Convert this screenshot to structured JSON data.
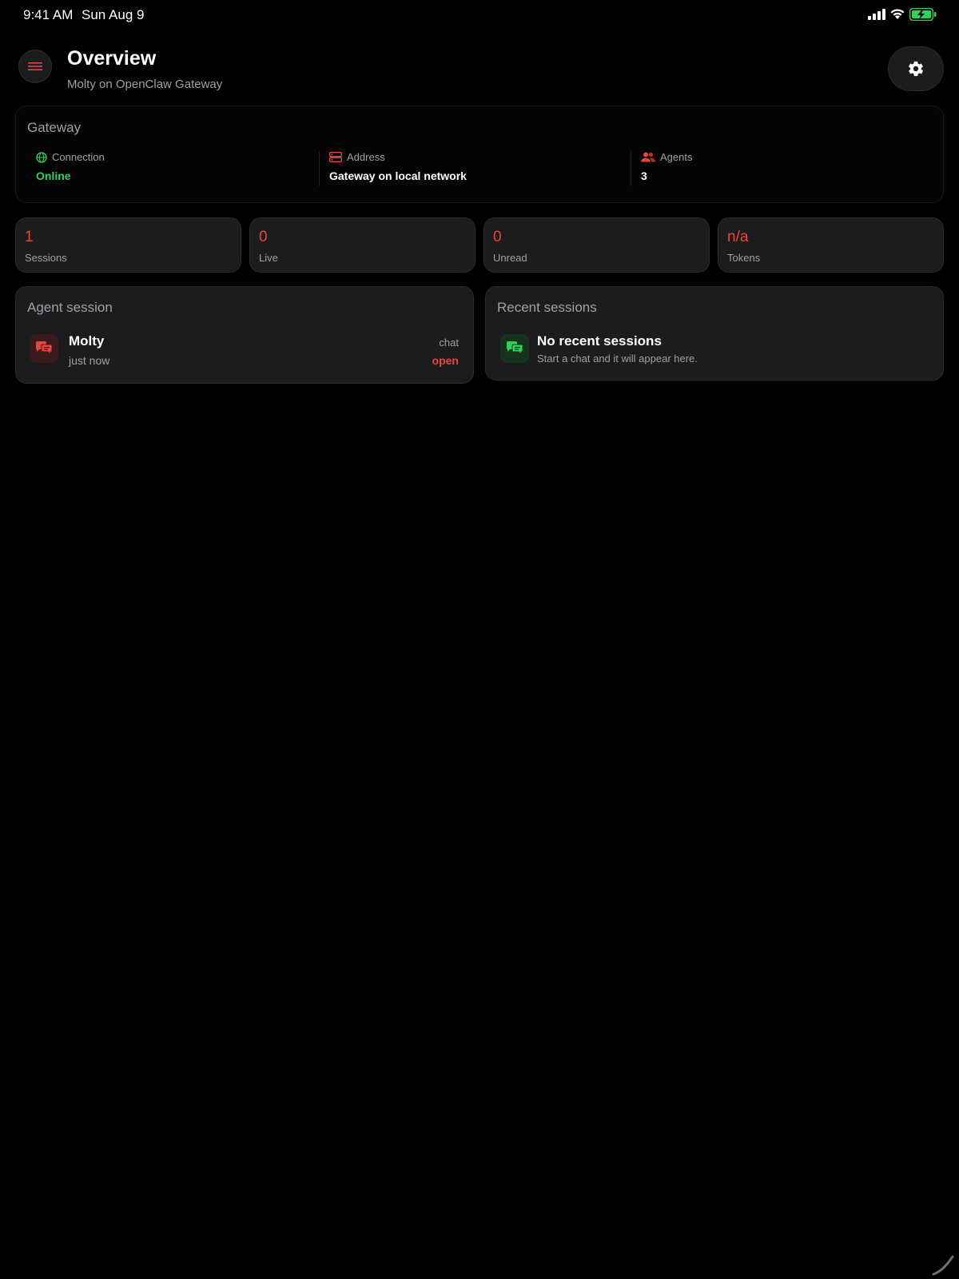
{
  "status_bar": {
    "time": "9:41 AM",
    "date": "Sun Aug 9",
    "icons": [
      "signal-icon",
      "wifi-icon",
      "battery-charging-icon"
    ],
    "battery_color": "#30d158"
  },
  "header": {
    "title": "Overview",
    "subtitle": "Molty on OpenClaw Gateway",
    "menu_icon": "hamburger-icon",
    "settings_icon": "gear-icon"
  },
  "gateway": {
    "title": "Gateway",
    "connection": {
      "label": "Connection",
      "value": "Online",
      "icon": "globe-icon"
    },
    "address": {
      "label": "Address",
      "value": "Gateway on local network",
      "icon": "server-icon"
    },
    "agents": {
      "label": "Agents",
      "value": "3",
      "icon": "people-icon"
    }
  },
  "stats": [
    {
      "value": "1",
      "label": "Sessions"
    },
    {
      "value": "0",
      "label": "Live"
    },
    {
      "value": "0",
      "label": "Unread"
    },
    {
      "value": "n/a",
      "label": "Tokens"
    }
  ],
  "agent_session": {
    "title": "Agent session",
    "name": "Molty",
    "time": "just now",
    "kind": "chat",
    "state": "open",
    "icon": "chat-bubbles-icon"
  },
  "recent_sessions": {
    "title": "Recent sessions",
    "empty_title": "No recent sessions",
    "empty_subtitle": "Start a chat and it will appear here.",
    "icon": "chat-bubbles-icon"
  },
  "colors": {
    "accent": "#e5453d",
    "success": "#30d158",
    "card": "#1c1c1e",
    "muted_text": "#a0a0a5"
  }
}
